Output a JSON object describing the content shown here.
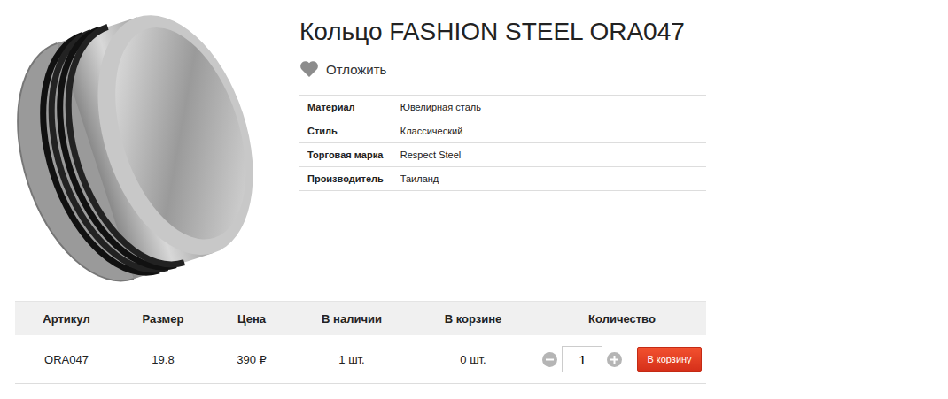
{
  "product": {
    "title": "Кольцо FASHION STEEL ORA047",
    "wishlist": "Отложить"
  },
  "properties": [
    {
      "label": "Материал",
      "value": "Ювелирная сталь"
    },
    {
      "label": "Стиль",
      "value": "Классический"
    },
    {
      "label": "Торговая марка",
      "value": "Respect Steel"
    },
    {
      "label": "Производитель",
      "value": "Таиланд"
    }
  ],
  "offers": {
    "columns": [
      "Артикул",
      "Размер",
      "Цена",
      "В наличии",
      "В корзине",
      "Количество"
    ],
    "rows": [
      {
        "sku": "ORA047",
        "size": "19.8",
        "price": "390 ₽",
        "stock": "1 шт.",
        "cart": "0 шт.",
        "quantity": "1",
        "button": "В корзину"
      }
    ]
  }
}
